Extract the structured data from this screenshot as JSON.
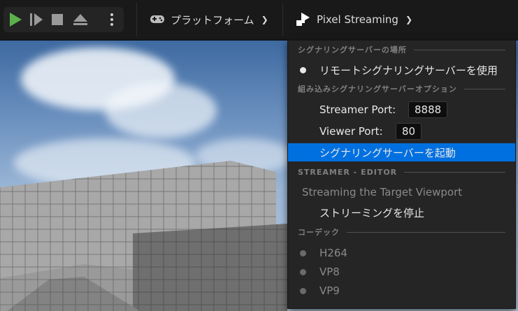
{
  "toolbar": {
    "platform_label": "プラットフォーム",
    "pixel_streaming_label": "Pixel Streaming"
  },
  "menu": {
    "section_signaling": "シグナリングサーバーの場所",
    "use_remote": "リモートシグナリングサーバーを使用",
    "section_embedded": "組み込みシグナリングサーバーオプション",
    "streamer_port_label": "Streamer Port:",
    "streamer_port_value": "8888",
    "viewer_port_label": "Viewer Port:",
    "viewer_port_value": "80",
    "launch_server": "シグナリングサーバーを起動",
    "section_streamer": "STREAMER - EDITOR",
    "streaming_target": "Streaming the Target Viewport",
    "stop_streaming": "ストリーミングを停止",
    "section_codec": "コーデック",
    "codecs": [
      "H264",
      "VP8",
      "VP9"
    ]
  },
  "colors": {
    "accent": "#0070e0",
    "play_green": "#5bb04b",
    "toolbar_bg": "#191919",
    "menu_bg": "#252525"
  }
}
